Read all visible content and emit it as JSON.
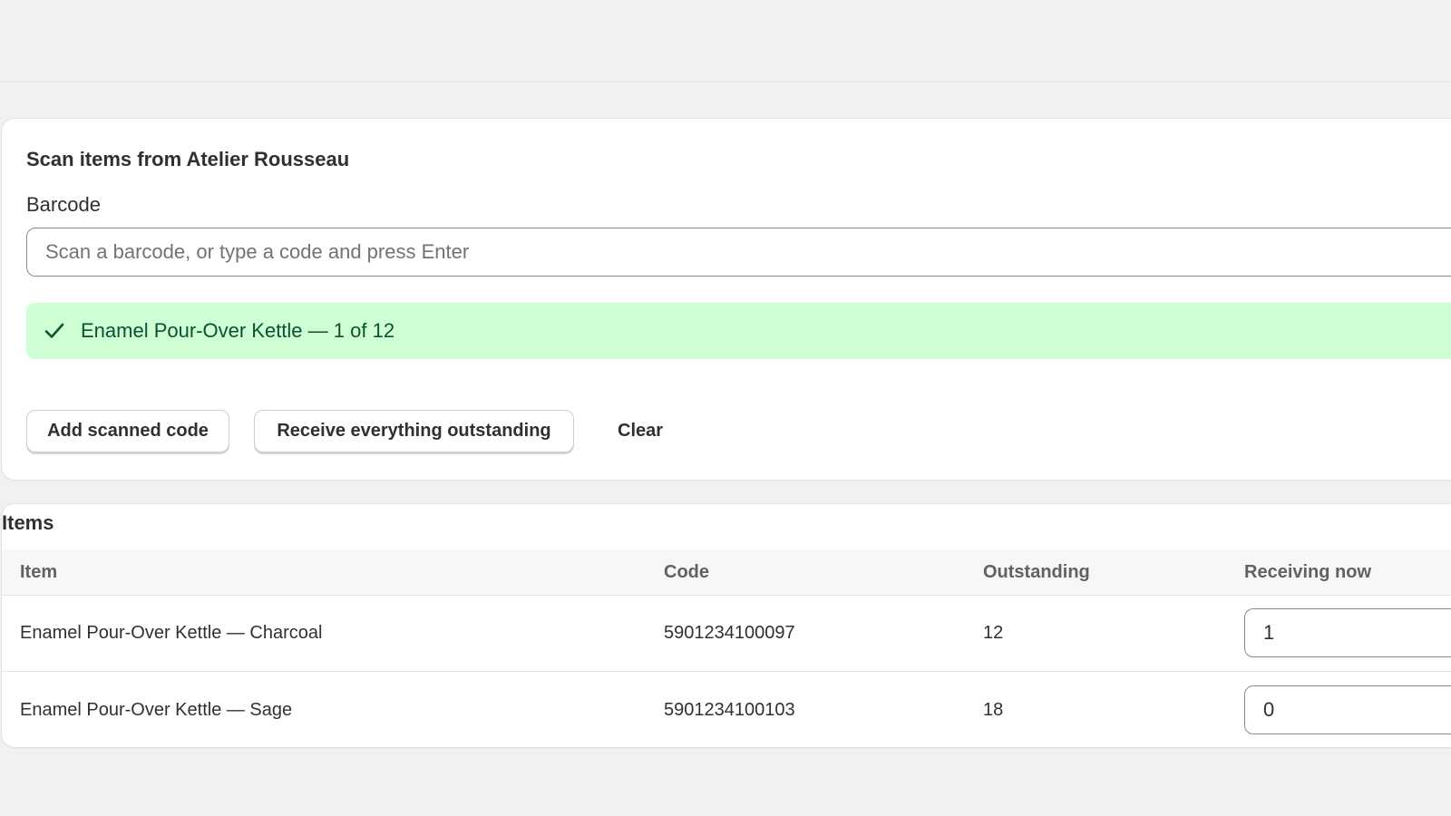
{
  "scan": {
    "title": "Scan items from Atelier Rousseau",
    "barcode_label": "Barcode",
    "barcode_placeholder": "Scan a barcode, or type a code and press Enter",
    "barcode_value": "",
    "banner_icon": "checkmark-icon",
    "banner_message": "Enamel Pour-Over Kettle — 1 of 12",
    "banner_color": "#cdfed4",
    "actions": {
      "add_label": "Add scanned code",
      "receive_label": "Receive everything outstanding",
      "clear_label": "Clear"
    }
  },
  "items": {
    "title": "Items",
    "columns": [
      "Item",
      "Code",
      "Outstanding",
      "Receiving now"
    ],
    "rows": [
      {
        "item": "Enamel Pour-Over Kettle — Charcoal",
        "code": "5901234100097",
        "outstanding": "12",
        "receiving": "1"
      },
      {
        "item": "Enamel Pour-Over Kettle — Sage",
        "code": "5901234100103",
        "outstanding": "18",
        "receiving": "0"
      }
    ]
  }
}
